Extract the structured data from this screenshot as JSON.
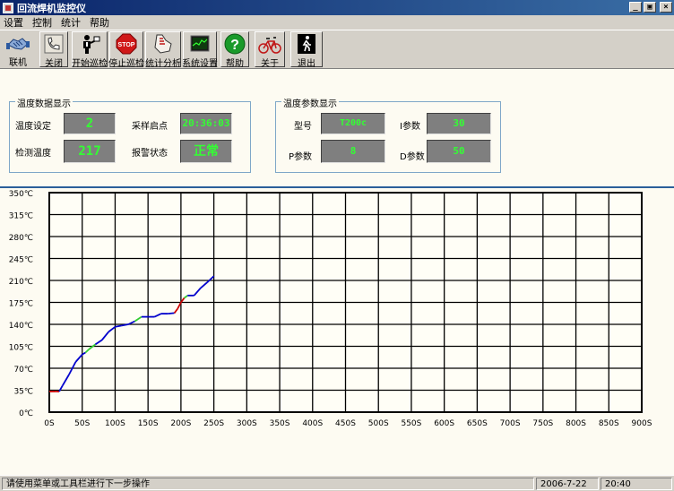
{
  "window": {
    "title": "回流焊机监控仪",
    "minimize": "_",
    "maximize": "▣",
    "close": "×"
  },
  "menu": [
    "设置",
    "控制",
    "统计",
    "帮助"
  ],
  "toolbar": [
    {
      "label": "联机",
      "icon": "handshake-icon"
    },
    {
      "label": "关闭",
      "icon": "phone-icon"
    },
    {
      "label": "开始巡检",
      "icon": "inspector-icon"
    },
    {
      "label": "停止巡检",
      "icon": "stop-sign-icon"
    },
    {
      "label": "统计分析",
      "icon": "hand-chart-icon"
    },
    {
      "label": "系统设置",
      "icon": "monitor-icon"
    },
    {
      "label": "帮助",
      "icon": "help-icon"
    },
    {
      "label": "关于",
      "icon": "bicycle-icon"
    },
    {
      "label": "退出",
      "icon": "exit-icon"
    }
  ],
  "temperature_group": {
    "title": "温度数据显示",
    "set_label": "温度设定",
    "set_value": "2",
    "sample_label": "采样启点",
    "sample_value": "20:36:03",
    "measured_label": "检测温度",
    "measured_value": "217",
    "alarm_label": "报警状态",
    "alarm_value": "正常"
  },
  "params_group": {
    "title": "温度参数显示",
    "model_label": "型号",
    "model_value": "T200c",
    "i_label": "I参数",
    "i_value": "30",
    "p_label": "P参数",
    "p_value": "8",
    "d_label": "D参数",
    "d_value": "50"
  },
  "colors": {
    "led_text": "#33ff33",
    "led_bg": "#7f7f7f",
    "grid": "#000000",
    "series": [
      "#0000cc",
      "#33cc33",
      "#cc0000"
    ]
  },
  "chart_data": {
    "type": "line",
    "x_ticks": [
      "0S",
      "50S",
      "100S",
      "150S",
      "200S",
      "250S",
      "300S",
      "350S",
      "400S",
      "450S",
      "500S",
      "550S",
      "600S",
      "650S",
      "700S",
      "750S",
      "800S",
      "850S",
      "900S"
    ],
    "y_ticks": [
      "0℃",
      "35℃",
      "70℃",
      "105℃",
      "140℃",
      "175℃",
      "210℃",
      "245℃",
      "280℃",
      "315℃",
      "350℃"
    ],
    "xlim": [
      0,
      900
    ],
    "ylim": [
      0,
      350
    ],
    "grid": true,
    "series": [
      {
        "x": [
          0,
          10,
          15,
          20,
          30,
          40,
          50,
          55,
          60,
          70,
          80,
          90,
          100,
          110,
          120,
          130,
          140,
          150,
          160,
          170,
          180,
          190,
          195,
          200,
          205,
          210,
          220,
          230,
          240,
          250
        ],
        "y": [
          33,
          33,
          33,
          42,
          60,
          80,
          92,
          95,
          100,
          108,
          115,
          128,
          136,
          138,
          140,
          145,
          152,
          152,
          152,
          157,
          157,
          158,
          165,
          175,
          182,
          186,
          186,
          198,
          207,
          217
        ]
      }
    ]
  },
  "status": {
    "message": "请使用菜单或工具栏进行下一步操作",
    "date": "2006-7-22",
    "time": "20:40"
  }
}
